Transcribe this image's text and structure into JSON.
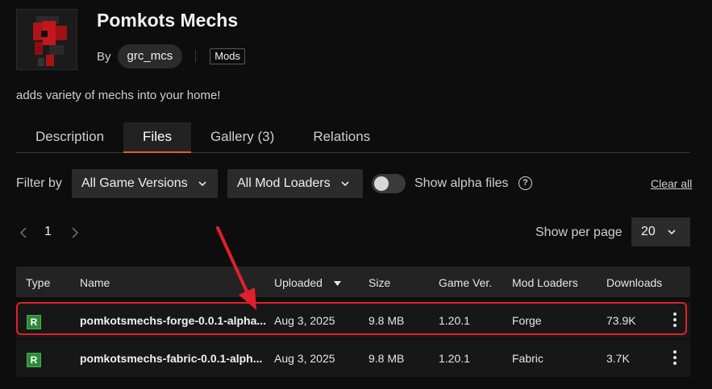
{
  "project": {
    "title": "Pomkots Mechs",
    "by_label": "By",
    "author": "grc_mcs",
    "tag": "Mods",
    "summary": "adds variety of mechs into your home!",
    "thumbnail_icon": "mech-thumbnail-image"
  },
  "tabs": [
    {
      "label": "Description",
      "active": false
    },
    {
      "label": "Files",
      "active": true
    },
    {
      "label": "Gallery (3)",
      "active": false
    },
    {
      "label": "Relations",
      "active": false
    }
  ],
  "filters": {
    "label": "Filter by",
    "game_versions": "All Game Versions",
    "mod_loaders": "All Mod Loaders",
    "alpha_toggle_label": "Show alpha files",
    "alpha_toggle_on": false,
    "clear_all": "Clear all"
  },
  "pagination": {
    "current_page": "1",
    "per_page_label": "Show per page",
    "per_page_value": "20"
  },
  "table": {
    "headers": [
      "Type",
      "Name",
      "Uploaded",
      "Size",
      "Game Ver.",
      "Mod Loaders",
      "Downloads"
    ],
    "rows": [
      {
        "type": "R",
        "name": "pomkotsmechs-forge-0.0.1-alpha...",
        "uploaded": "Aug 3, 2025",
        "size": "9.8 MB",
        "game_ver": "1.20.1",
        "loader": "Forge",
        "downloads": "73.9K",
        "highlighted": true
      },
      {
        "type": "R",
        "name": "pomkotsmechs-fabric-0.0.1-alph...",
        "uploaded": "Aug 3, 2025",
        "size": "9.8 MB",
        "game_ver": "1.20.1",
        "loader": "Fabric",
        "downloads": "3.7K",
        "highlighted": false
      }
    ]
  },
  "colors": {
    "accent": "#e85b2d",
    "release_badge": "#2d8a3a",
    "annotation_red": "#e0202a"
  }
}
